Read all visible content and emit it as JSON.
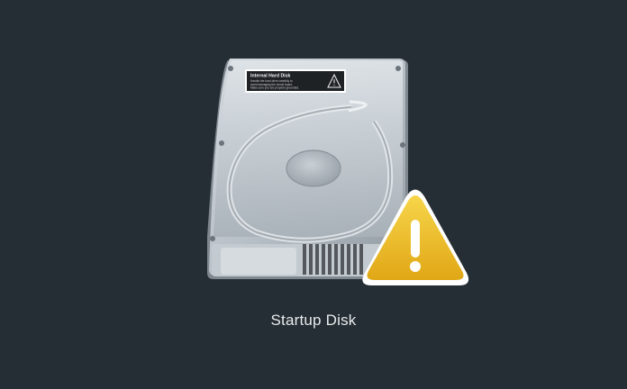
{
  "disk": {
    "name": "Startup Disk",
    "icon": "internal-hard-disk-icon",
    "status_icon": "warning-icon"
  },
  "disk_sticker": {
    "title": "Internal Hard Disk",
    "line1": "Handle the hard drive carefully to",
    "line2": "avoid damaging the circuit board.",
    "line3": "Make sure you are properly grounded."
  }
}
